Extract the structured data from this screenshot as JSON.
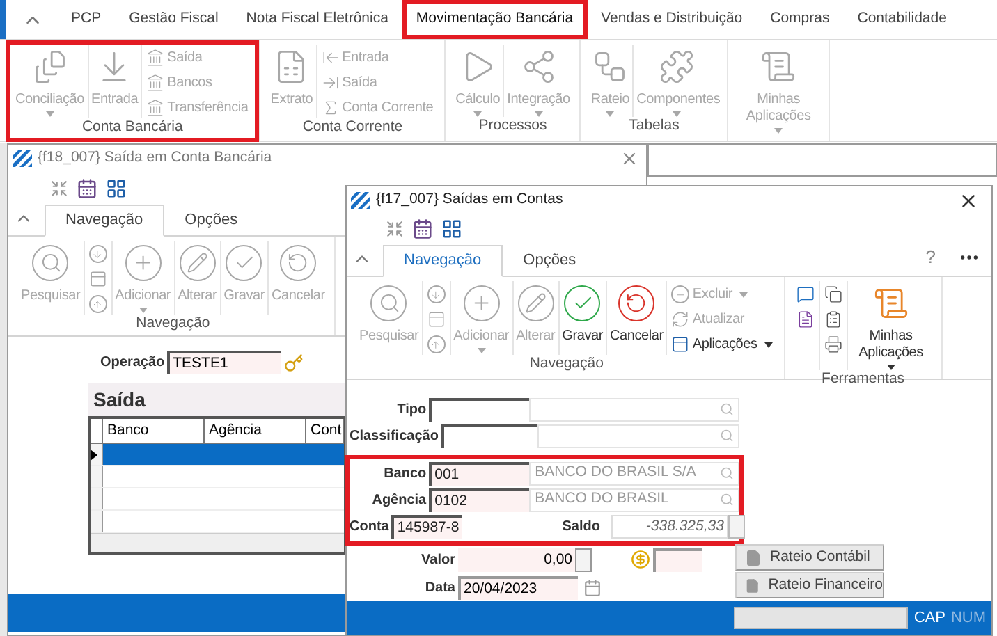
{
  "ribbon": {
    "tabs": [
      {
        "label": "PCP",
        "selected": false,
        "highlighted": false
      },
      {
        "label": "Gestão Fiscal",
        "selected": false,
        "highlighted": false
      },
      {
        "label": "Nota Fiscal Eletrônica",
        "selected": false,
        "highlighted": false
      },
      {
        "label": "Movimentação Bancária",
        "selected": true,
        "highlighted": true
      },
      {
        "label": "Vendas e Distribuição",
        "selected": false,
        "highlighted": false
      },
      {
        "label": "Compras",
        "selected": false,
        "highlighted": false
      },
      {
        "label": "Contabilidade",
        "selected": false,
        "highlighted": false
      }
    ],
    "groups": [
      {
        "label": "Conta Bancária",
        "highlighted": true,
        "columns": [
          {
            "kind": "large",
            "label": "Conciliação",
            "disabled": true,
            "dropdown": true
          },
          {
            "kind": "large",
            "label": "Entrada",
            "disabled": true,
            "dropdown": false
          },
          {
            "kind": "stack",
            "items": [
              {
                "label": "Saída",
                "disabled": true,
                "dropdown": false
              },
              {
                "label": "Bancos",
                "disabled": true,
                "dropdown": false
              },
              {
                "label": "Transferência",
                "disabled": true,
                "dropdown": false
              }
            ]
          }
        ]
      },
      {
        "label": "Conta Corrente",
        "highlighted": false,
        "columns": [
          {
            "kind": "large",
            "label": "Extrato",
            "disabled": true,
            "dropdown": false
          },
          {
            "kind": "stack",
            "items": [
              {
                "label": "Entrada",
                "disabled": true,
                "dropdown": false
              },
              {
                "label": "Saída",
                "disabled": true,
                "dropdown": false
              },
              {
                "label": "Conta Corrente",
                "disabled": true,
                "dropdown": false
              }
            ]
          }
        ]
      },
      {
        "label": "Processos",
        "highlighted": false,
        "columns": [
          {
            "kind": "large",
            "label": "Cálculo",
            "disabled": true,
            "dropdown": true
          },
          {
            "kind": "large",
            "label": "Integração",
            "disabled": true,
            "dropdown": true
          }
        ]
      },
      {
        "label": "Tabelas",
        "highlighted": false,
        "columns": [
          {
            "kind": "large",
            "label": "Rateio",
            "disabled": true,
            "dropdown": true
          },
          {
            "kind": "large",
            "label": "Componentes",
            "disabled": true,
            "dropdown": true
          }
        ]
      },
      {
        "highlighted": false,
        "columns": [
          {
            "kind": "large",
            "label": "Minhas Aplicações",
            "disabled": true,
            "dropdown": true
          }
        ]
      }
    ]
  },
  "window_back": {
    "title": "{f18_007} Saída em Conta Bancária",
    "tabs": [
      {
        "label": "Navegação",
        "selected": true
      },
      {
        "label": "Opções",
        "selected": false
      }
    ],
    "groups": [
      {
        "label": "Navegação",
        "highlighted": false,
        "columns": [
          {
            "kind": "large",
            "label": "Pesquisar",
            "disabled": true,
            "dropdown": false
          },
          {
            "kind": "stack",
            "items": [
              {
                "disabled": true,
                "dropdown": false
              },
              {
                "disabled": true,
                "dropdown": false
              },
              {
                "disabled": true,
                "dropdown": false
              }
            ]
          },
          {
            "kind": "large",
            "label": "Adicionar",
            "disabled": true,
            "dropdown": true
          },
          {
            "kind": "large",
            "label": "Alterar",
            "disabled": true,
            "dropdown": false
          },
          {
            "kind": "large",
            "label": "Gravar",
            "disabled": true,
            "dropdown": false
          },
          {
            "kind": "large",
            "label": "Cancelar",
            "disabled": true,
            "dropdown": false
          }
        ]
      }
    ],
    "operacao": {
      "label": "Operação",
      "value": "TESTE1"
    },
    "panel": {
      "title": "Saída",
      "columns": [
        "Banco",
        "Agência",
        "Cont"
      ],
      "rows": [
        {
          "selected": true
        },
        {
          "selected": false
        },
        {
          "selected": false
        },
        {
          "selected": false
        }
      ]
    }
  },
  "window_front": {
    "title": "{f17_007} Saídas em Contas",
    "tabs": [
      {
        "label": "Navegação",
        "selected": true
      },
      {
        "label": "Opções",
        "selected": false
      }
    ],
    "help": "?",
    "groups": [
      {
        "label": "Navegação",
        "highlighted": false,
        "columns": [
          {
            "kind": "large",
            "label": "Pesquisar",
            "disabled": true,
            "dropdown": false
          },
          {
            "kind": "stack",
            "items": [
              {
                "disabled": true,
                "dropdown": false
              },
              {
                "disabled": true,
                "dropdown": false
              },
              {
                "disabled": true,
                "dropdown": false
              }
            ]
          },
          {
            "kind": "large",
            "label": "Adicionar",
            "disabled": true,
            "dropdown": true
          },
          {
            "kind": "large",
            "label": "Alterar",
            "disabled": true,
            "dropdown": false
          },
          {
            "kind": "large",
            "label": "Gravar",
            "disabled": false,
            "dropdown": false
          },
          {
            "kind": "large",
            "label": "Cancelar",
            "disabled": false,
            "dropdown": false
          },
          {
            "kind": "stack",
            "items": [
              {
                "label": "Excluir",
                "disabled": true,
                "dropdown": true
              },
              {
                "label": "Atualizar",
                "disabled": true,
                "dropdown": false
              },
              {
                "label": "Aplicações",
                "disabled": false,
                "dropdown": true
              }
            ]
          }
        ]
      },
      {
        "label": "Ferramentas",
        "highlighted": false,
        "columns": [
          {
            "kind": "stack",
            "items": [
              {
                "disabled": false,
                "dropdown": false
              },
              {
                "disabled": false,
                "dropdown": false
              }
            ]
          },
          {
            "kind": "stack",
            "items": [
              {
                "disabled": false,
                "dropdown": false
              },
              {
                "disabled": false,
                "dropdown": false
              },
              {
                "disabled": false,
                "dropdown": false
              }
            ]
          },
          {
            "kind": "large",
            "label": "Minhas Aplicações",
            "disabled": false,
            "dropdown": true
          }
        ]
      }
    ],
    "form": {
      "groups": [
        {
          "highlighted": false,
          "fields": [
            {
              "label": "Tipo"
            },
            {
              "label": "Classificação"
            }
          ]
        },
        {
          "highlighted": true,
          "fields": [
            {
              "label": "Banco",
              "code": "001",
              "description": "BANCO DO BRASIL S/A"
            },
            {
              "label": "Agência",
              "code": "0102",
              "description": "BANCO DO BRASIL"
            },
            {
              "label": "Conta",
              "code": "145987-8",
              "saldo": {
                "label": "Saldo",
                "value": "-338.325,33"
              }
            }
          ]
        }
      ],
      "valor": {
        "label": "Valor",
        "value": "0,00"
      },
      "data": {
        "label": "Data",
        "value": "20/04/2023"
      },
      "buttons": [
        "Rateio Contábil",
        "Rateio Financeiro"
      ]
    },
    "status": [
      {
        "label": "CAP",
        "on": true
      },
      {
        "label": "NUM",
        "on": false
      }
    ]
  }
}
